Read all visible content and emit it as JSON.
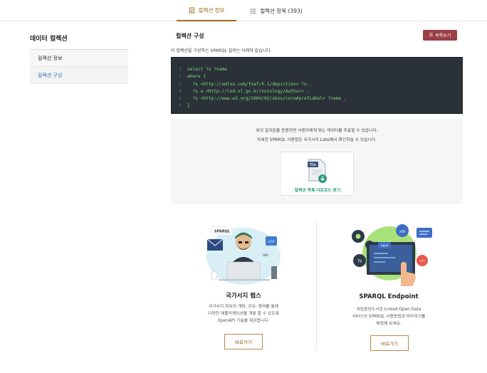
{
  "tabs": [
    {
      "label": "컬렉션 정보",
      "active": true
    },
    {
      "label": "컬렉션 항목 (393)",
      "active": false
    }
  ],
  "sidebar": {
    "title": "데이터 컬렉션",
    "items": [
      {
        "label": "컬렉션 정보",
        "active": false
      },
      {
        "label": "컬렉션 구성",
        "active": true
      }
    ]
  },
  "main": {
    "title": "컬렉션 구성",
    "list_button": "목록보기",
    "description": "이 컬렉션을 구성하는 SPARQL 질의는 아래와 같습니다.",
    "code_lines": [
      {
        "n": "1",
        "text": "select ?s ?name"
      },
      {
        "n": "2",
        "text": "where {"
      },
      {
        "n": "3",
        "text": "  ?s <http://xmlns.com/foaf/0.1/depiction> ?o."
      },
      {
        "n": "4",
        "text": "  ?s a <http://lod.nl.go.kr/ontology/Author> ."
      },
      {
        "n": "5",
        "text": "  ?s <http://www.w3.org/2004/02/skos/core#prefLabel> ?name ."
      },
      {
        "n": "6",
        "text": "}"
      }
    ]
  },
  "info": {
    "line1": "위의 질의문을 응용하면 사용자에게 맞는 데이터를 추출할 수 있습니다.",
    "line2": "자세한 SPARQL 사용법은 국가서지 Labs에서 확인하실 수 있습니다.",
    "file_label": "File",
    "download_label": "컬렉션 목록 다운로드 받기"
  },
  "cards": [
    {
      "title": "국가서지 랩스",
      "desc": [
        "국가서지 정보의 개방, 공유, 참여를 통해",
        "다양한 애플리케이션을 개발 할 수 있도록",
        "OpenAPI 기술을 제공합니다."
      ],
      "button": "바로가기",
      "illus_words": [
        "SPARQL",
        "</>",
        "URI"
      ]
    },
    {
      "title": "SPARQL Endpoint",
      "desc": [
        "국립중앙도서관 Linked Open Data",
        "서비스의 SPARQL 사용방법과 따라하기를",
        "체험해 보세요."
      ],
      "button": "바로가기",
      "illus_words": [
        "rdf",
        "html",
        "?s",
        "</>"
      ]
    }
  ],
  "colors": {
    "accent": "#a26a1b",
    "list_button": "#9b3e46",
    "code_bg": "#2b3139",
    "code_text": "#7ddc7a",
    "download": "#2a9d7b"
  }
}
